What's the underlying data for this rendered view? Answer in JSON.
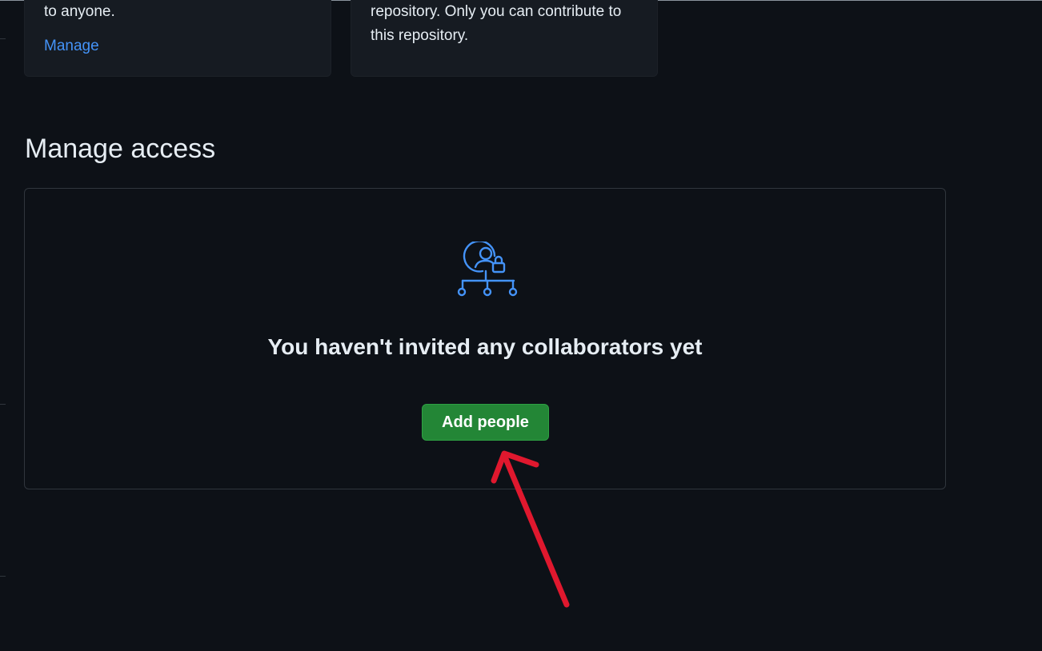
{
  "cards": {
    "visibility_text": "to anyone.",
    "manage_link": "Manage",
    "access_text": "repository. Only you can contribute to this repository."
  },
  "manage_access": {
    "title": "Manage access",
    "empty_heading": "You haven't invited any collaborators yet",
    "add_button_label": "Add people",
    "icon": "person-lock-network-icon"
  },
  "annotation": {
    "arrow_color": "#e0182e"
  },
  "colors": {
    "background": "#0d1117",
    "card": "#161b22",
    "link": "#4493f8",
    "primary_button": "#238636",
    "icon_accent": "#4493f8"
  }
}
